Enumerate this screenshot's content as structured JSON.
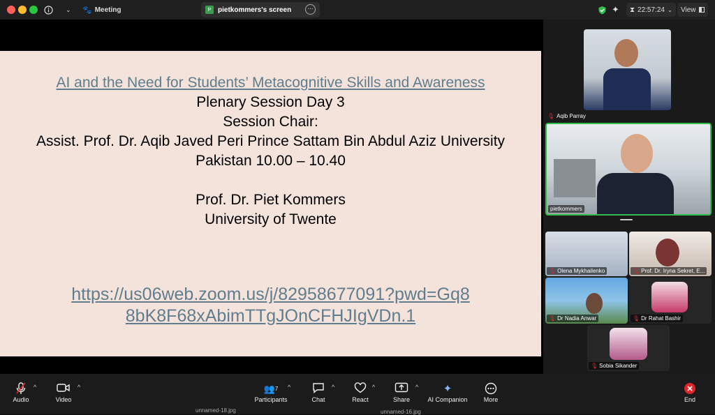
{
  "titlebar": {
    "app_title": "Meeting",
    "share_tab": "pietkommers's screen",
    "share_badge": "P",
    "clock": "22:57:24",
    "view_label": "View"
  },
  "slide": {
    "title_link": "AI and the Need for Students’ Metacognitive Skills and Awareness",
    "line1": "Plenary Session Day 3",
    "line2": "Session Chair:",
    "line3": "Assist. Prof. Dr. Aqib Javed Peri Prince Sattam Bin Abdul Aziz University",
    "line4": "Pakistan 10.00 – 10.40",
    "line5": "Prof. Dr. Piet Kommers",
    "line6": "University of Twente",
    "url1": "https://us06web.zoom.us/j/82958677091?pwd=Gq8",
    "url2": "8bK8F68xAbimTTgJOnCFHJIgVDn.1"
  },
  "participants_panel": {
    "tiles": [
      {
        "name": "Aqib Parray",
        "muted": true
      },
      {
        "name": "pietkommers",
        "muted": false,
        "active_speaker": true
      },
      {
        "name": "Olena Mykhailenko",
        "muted": true
      },
      {
        "name": "Prof. Dr. Iryna Sekret, E...",
        "muted": true
      },
      {
        "name": "Dr Nadia Anwar",
        "muted": true
      },
      {
        "name": "Dr Rahat Bashir",
        "muted": true
      },
      {
        "name": "Sobia Sikander",
        "muted": true
      }
    ]
  },
  "toolbar": {
    "audio": "Audio",
    "video": "Video",
    "participants": "Participants",
    "participants_count": "7",
    "chat": "Chat",
    "react": "React",
    "share": "Share",
    "ai_companion": "AI Companion",
    "more": "More",
    "end": "End"
  },
  "desktop": {
    "file1": "unnamed-18.jpg",
    "file2": "unnamed-16.jpg"
  },
  "colors": {
    "active_border": "#2fbf4a",
    "end_red": "#e0262d",
    "link": "#607d8f",
    "slide_bg": "#f4e3da"
  }
}
